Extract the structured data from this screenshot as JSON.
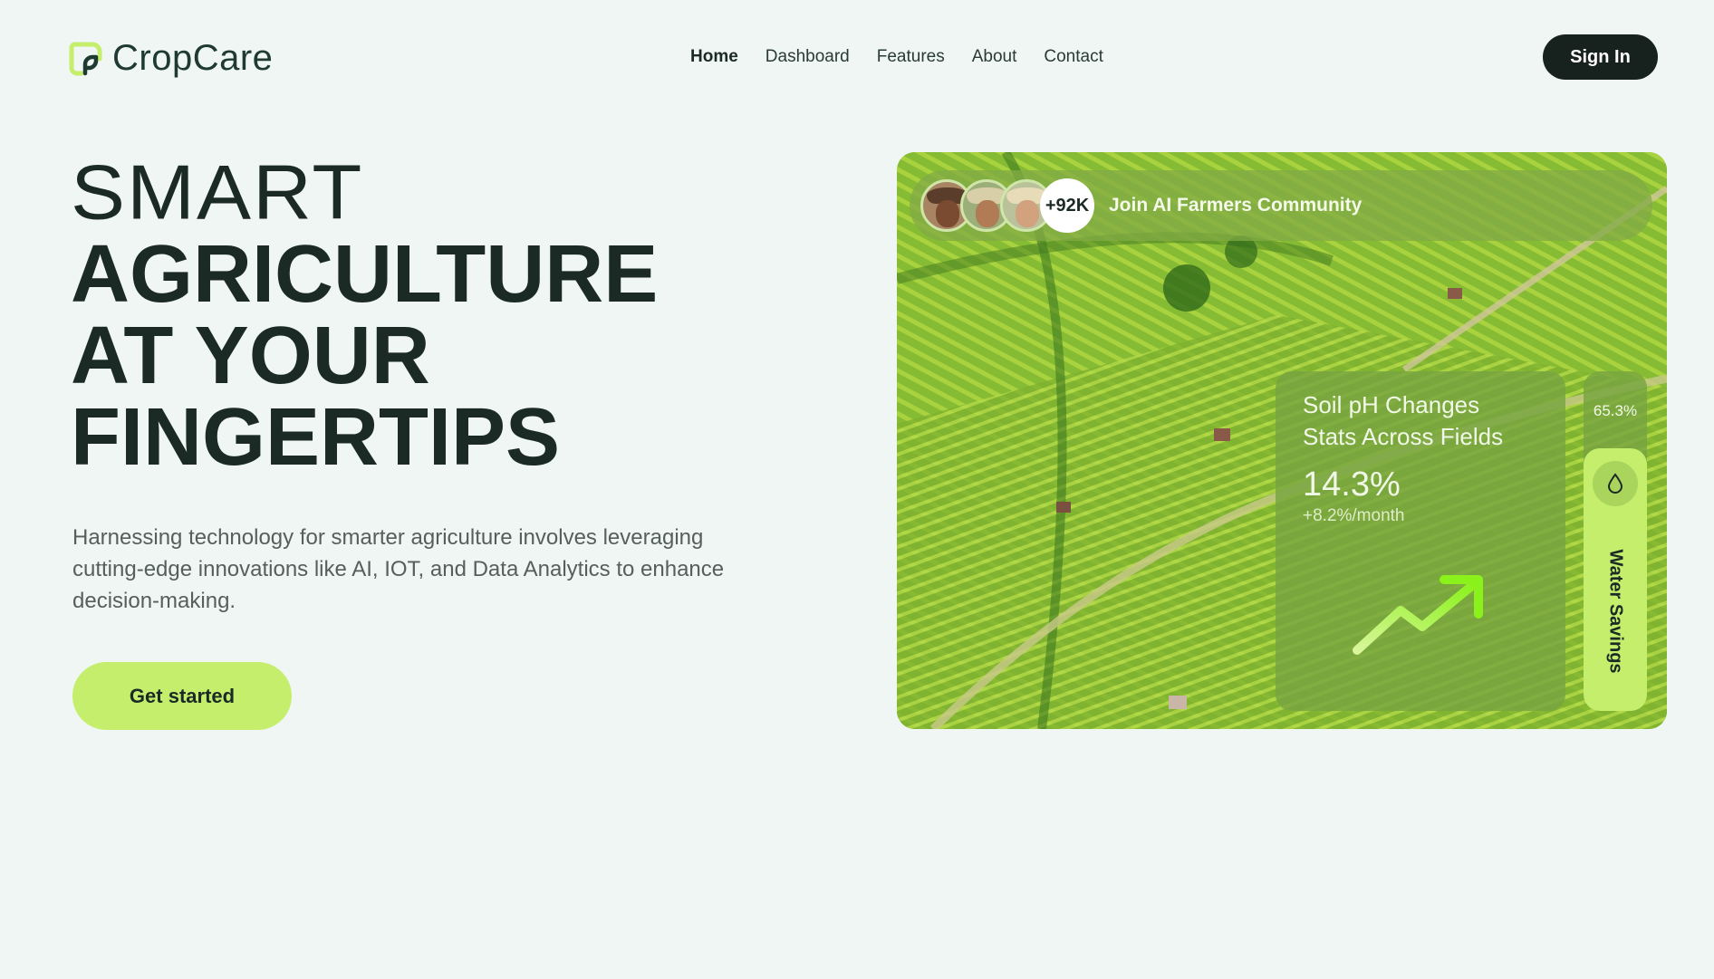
{
  "brand": {
    "name": "CropCare",
    "accent": "#c4ee6c",
    "dark": "#17211e"
  },
  "nav": {
    "items": [
      {
        "label": "Home",
        "active": true
      },
      {
        "label": "Dashboard",
        "active": false
      },
      {
        "label": "Features",
        "active": false
      },
      {
        "label": "About",
        "active": false
      },
      {
        "label": "Contact",
        "active": false
      }
    ],
    "signin_label": "Sign In"
  },
  "hero": {
    "line1": "SMART",
    "line2": "AGRICULTURE",
    "line3": "AT YOUR",
    "line4": "FINGERTIPS",
    "lead": "Harnessing technology for smarter agriculture involves leveraging cutting-edge innovations like AI, IOT, and Data Analytics to enhance decision-making.",
    "cta_label": "Get started"
  },
  "community": {
    "count": "+92K",
    "label": "Join AI Farmers Community",
    "avatars": [
      "farmer-avatar-1",
      "farmer-avatar-2",
      "farmer-avatar-3"
    ]
  },
  "stats_card": {
    "title": "Soil pH Changes Stats Across Fields",
    "value": "14.3%",
    "delta": "+8.2%/month",
    "trend_icon": "trend-up-arrow-icon"
  },
  "water_card": {
    "percent": "65.3%",
    "label": "Water Savings",
    "icon": "water-drop-icon"
  }
}
